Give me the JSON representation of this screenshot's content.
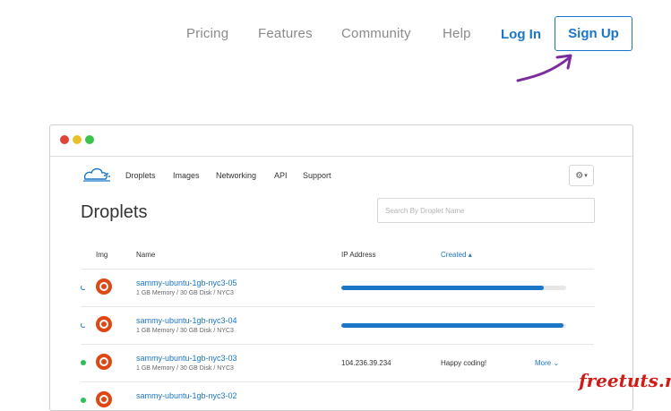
{
  "topnav": {
    "items": [
      "Pricing",
      "Features",
      "Community",
      "Help"
    ],
    "login": "Log In",
    "signup": "Sign Up"
  },
  "app": {
    "nav": [
      "Droplets",
      "Images",
      "Networking",
      "API",
      "Support"
    ],
    "gear_icon": "gear-icon",
    "title": "Droplets",
    "search_placeholder": "Search By Droplet Name",
    "columns": {
      "img": "Img",
      "name": "Name",
      "ip": "IP Address",
      "created": "Created"
    },
    "droplets": [
      {
        "name": "sammy-ubuntu-1gb-nyc3-05",
        "meta": "1 GB Memory / 30 GB Disk / NYC3",
        "status": "creating",
        "progress": 0.9
      },
      {
        "name": "sammy-ubuntu-1gb-nyc3-04",
        "meta": "1 GB Memory / 30 GB Disk / NYC3",
        "status": "creating",
        "progress": 0.99
      },
      {
        "name": "sammy-ubuntu-1gb-nyc3-03",
        "meta": "1 GB Memory / 30 GB Disk / NYC3",
        "status": "active",
        "ip": "104.236.39.234",
        "created": "Happy coding!",
        "more": "More"
      },
      {
        "name": "sammy-ubuntu-1gb-nyc3-02",
        "status": "active"
      }
    ]
  },
  "watermark": "freetuts.net",
  "colors": {
    "accent": "#1a76c7",
    "active": "#2ebd59",
    "ubuntu": "#dd4814",
    "arrow": "#7b2d9e"
  }
}
